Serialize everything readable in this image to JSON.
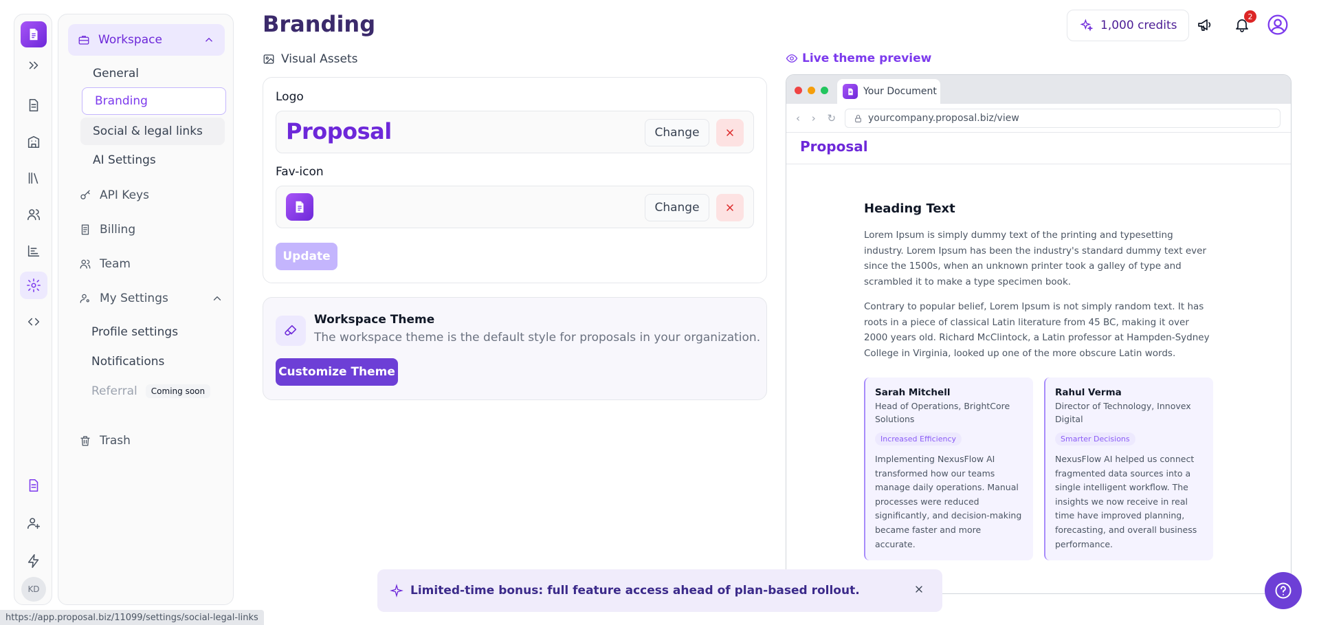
{
  "page": {
    "title": "Branding"
  },
  "header": {
    "credits_label": "1,000 credits",
    "notifications_count": "2"
  },
  "rail": {
    "avatar_initials": "KD"
  },
  "subnav": {
    "workspace_label": "Workspace",
    "workspace_items": [
      {
        "label": "General"
      },
      {
        "label": "Branding"
      },
      {
        "label": "Social & legal links"
      },
      {
        "label": "AI Settings"
      }
    ],
    "api_keys": "API Keys",
    "billing": "Billing",
    "team": "Team",
    "my_settings": "My Settings",
    "my_settings_items": [
      {
        "label": "Profile settings"
      },
      {
        "label": "Notifications"
      },
      {
        "label": "Referral",
        "badge": "Coming soon"
      }
    ],
    "trash": "Trash"
  },
  "visual_assets": {
    "section_label": "Visual Assets",
    "logo_label": "Logo",
    "logo_text": "Proposal",
    "favicon_label": "Fav-icon",
    "change_label": "Change",
    "update_label": "Update"
  },
  "theme": {
    "title": "Workspace Theme",
    "description": "The workspace theme is the default style for proposals in your organization.",
    "button": "Customize Theme"
  },
  "preview": {
    "label": "Live theme preview",
    "tab_title": "Your Document",
    "url": "yourcompany.proposal.biz/view",
    "site_logo": "Proposal",
    "heading": "Heading Text",
    "paragraph1": "Lorem Ipsum is simply dummy text of the printing and typesetting industry. Lorem Ipsum has been the industry's standard dummy text ever since the 1500s, when an unknown printer took a galley of type and scrambled it to make a type specimen book.",
    "paragraph2": "Contrary to popular belief, Lorem Ipsum is not simply random text. It has roots in a piece of classical Latin literature from 45 BC, making it over 2000 years old. Richard McClintock, a Latin professor at Hampden-Sydney College in Virginia, looked up one of the more obscure Latin words.",
    "testimonials": [
      {
        "name": "Sarah Mitchell",
        "role": "Head of Operations, BrightCore Solutions",
        "tag": "Increased Efficiency",
        "body": "Implementing NexusFlow AI transformed how our teams manage daily operations. Manual processes were reduced significantly, and decision-making became faster and more accurate."
      },
      {
        "name": "Rahul Verma",
        "role": "Director of Technology, Innovex Digital",
        "tag": "Smarter Decisions",
        "body": "NexusFlow AI helped us connect fragmented data sources into a single intelligent workflow. The insights we now receive in real time have improved planning, forecasting, and overall business performance."
      }
    ]
  },
  "banner": {
    "text": "Limited-time bonus: full feature access ahead of plan-based rollout."
  },
  "statusbar": {
    "url": "https://app.proposal.biz/11099/settings/social-legal-links"
  },
  "colors": {
    "accent": "#6d28d9",
    "accent_light": "#ede9fe",
    "danger": "#dc2626"
  }
}
